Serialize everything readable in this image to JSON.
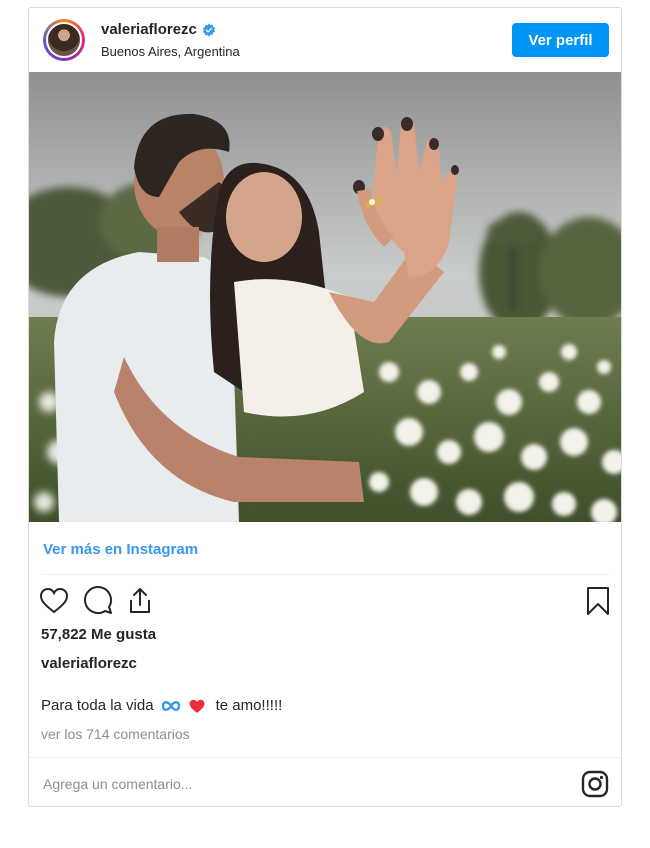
{
  "header": {
    "username": "valeriaflorezc",
    "location": "Buenos Aires, Argentina",
    "profile_button": "Ver perfil"
  },
  "photo": {
    "description_icon": "engagement-photo"
  },
  "post": {
    "more_link": "Ver más en Instagram",
    "likes": "57,822 Me gusta",
    "owner": "valeriaflorezc",
    "caption_text": "Para toda la vida",
    "caption_end": "te amo!!!!!",
    "comments_link": "ver los 714 comentarios"
  },
  "comment_bar": {
    "placeholder": "Agrega un comentario..."
  },
  "colors": {
    "accent": "#0095f6",
    "link": "#3897f0",
    "heart": "#ed4956",
    "infinity": "#3897f0"
  },
  "icons": [
    "heart-icon",
    "comment-icon",
    "share-icon",
    "bookmark-icon",
    "instagram-icon",
    "verified-badge-icon",
    "infinity-icon",
    "red-heart-icon"
  ]
}
